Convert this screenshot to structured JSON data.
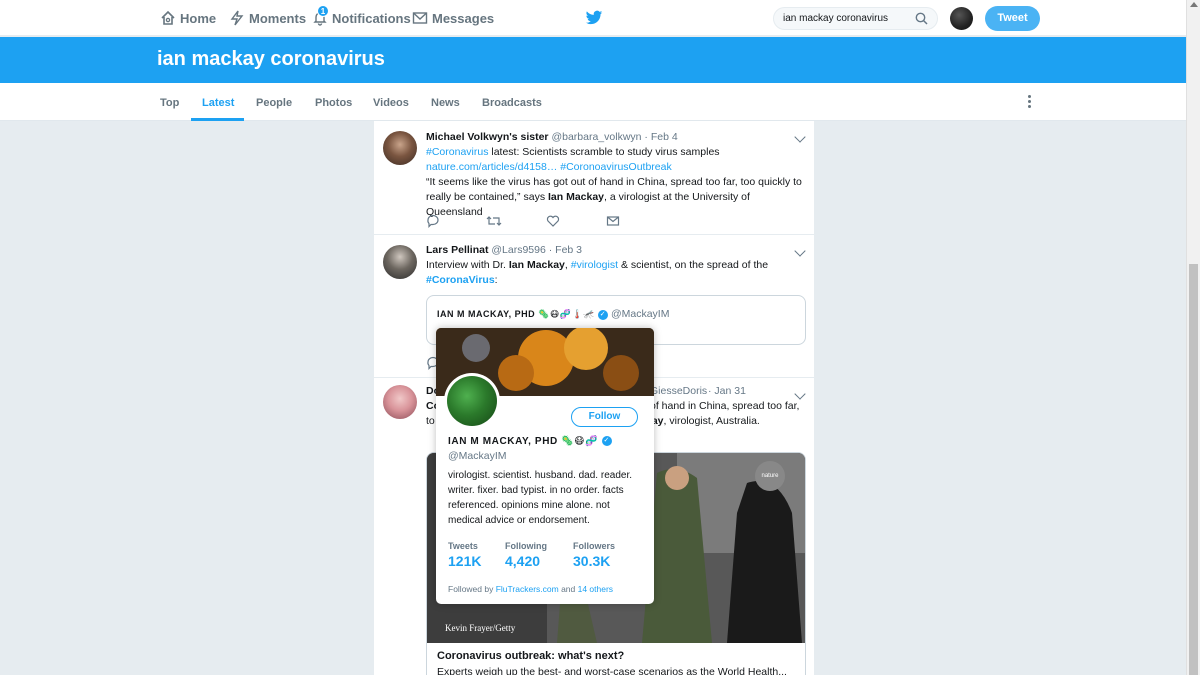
{
  "topnav": {
    "home": "Home",
    "moments": "Moments",
    "notifications": "Notifications",
    "notifications_count": "1",
    "messages": "Messages",
    "search_value": "ian mackay coronavirus",
    "tweet_button": "Tweet"
  },
  "banner": {
    "title": "ian mackay coronavirus"
  },
  "tabs": [
    "Top",
    "Latest",
    "People",
    "Photos",
    "Videos",
    "News",
    "Broadcasts"
  ],
  "tweets": [
    {
      "name": "Michael Volkwyn's sister",
      "handle": "@barbara_volkwyn",
      "date": "· Feb 4",
      "hashtag1": "#Coronavirus",
      "text1": " latest: Scientists scramble to study virus samples",
      "link": "nature.com/articles/d4158…",
      "hashtag2": " #CoronoavirusOutbreak",
      "text2a": " “It seems like the virus has got out of hand in China, spread too far, too quickly to really be contained,” says ",
      "bold": "Ian Mackay",
      "text2b": ", a virologist at the University of Queensland"
    },
    {
      "name": "Lars Pellinat",
      "handle": "@Lars9596",
      "date": "· Feb 3",
      "text1": "Interview with Dr. ",
      "bold": "Ian Mackay",
      "text2": ", ",
      "hashtag1": "#virologist",
      "text3": " & scientist, on the spread of the ",
      "hashtag2": "#CoronaVirus",
      "text4": ":",
      "quote_name": "IAN M MACKAY, PHD",
      "quote_emoji": "🦠😷🧬🌡️🦟",
      "quote_handle": "@MackayIM"
    },
    {
      "name": "Do",
      "handle": "GiesseDoris",
      "date": "· Jan 31",
      "line1_start": "Co",
      "line1_end": "of hand in China, spread too far,",
      "line2_start": "to",
      "line2_bold": "kay",
      "line2_end": ", virologist, Australia.",
      "media_credit": "Kevin Frayer/Getty",
      "nature_badge": "nature",
      "card_title": "Coronavirus outbreak: what's next?",
      "card_desc": "Experts weigh up the best- and worst-case scenarios as the World Health..."
    }
  ],
  "hovercard": {
    "follow": "Follow",
    "name": "IAN M MACKAY, PHD",
    "emoji": "🦠😷🧬",
    "handle": "@MackayIM",
    "bio": "virologist. scientist. husband. dad. reader. writer. fixer. bad typist. in no order. facts referenced. opinions mine alone. not medical advice or endorsement.",
    "tweets_label": "Tweets",
    "tweets_value": "121K",
    "following_label": "Following",
    "following_value": "4,420",
    "followers_label": "Followers",
    "followers_value": "30.3K",
    "followed_by_prefix": "Followed by ",
    "followed_by_link": "FluTrackers.com",
    "followed_by_and": " and ",
    "followed_by_others": "14 others"
  },
  "colors": {
    "accent": "#1da1f2",
    "banner": "#1da1f2",
    "background": "#e6ecf0"
  }
}
